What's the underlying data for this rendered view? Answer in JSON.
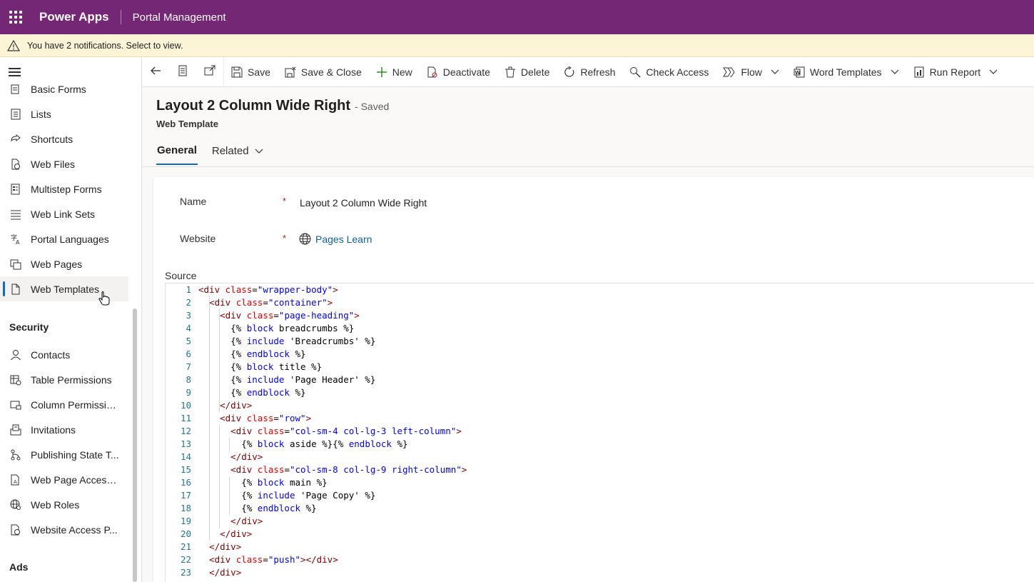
{
  "topbar": {
    "app_name": "Power Apps",
    "app_sub": "Portal Management"
  },
  "notification": {
    "text": "You have 2 notifications. Select to view."
  },
  "sidebar": {
    "items": [
      {
        "label": "Basic Forms",
        "icon": "form-icon"
      },
      {
        "label": "Lists",
        "icon": "list-icon"
      },
      {
        "label": "Shortcuts",
        "icon": "shortcut-icon"
      },
      {
        "label": "Web Files",
        "icon": "web-file-icon"
      },
      {
        "label": "Multistep Forms",
        "icon": "multistep-icon"
      },
      {
        "label": "Web Link Sets",
        "icon": "link-sets-icon"
      },
      {
        "label": "Portal Languages",
        "icon": "language-icon"
      },
      {
        "label": "Web Pages",
        "icon": "web-pages-icon"
      },
      {
        "label": "Web Templates",
        "icon": "template-icon",
        "active": true
      }
    ],
    "security_header": "Security",
    "security_items": [
      {
        "label": "Contacts",
        "icon": "person-icon"
      },
      {
        "label": "Table Permissions",
        "icon": "table-permission-icon"
      },
      {
        "label": "Column Permissio...",
        "icon": "column-permission-icon"
      },
      {
        "label": "Invitations",
        "icon": "invitation-icon"
      },
      {
        "label": "Publishing State T...",
        "icon": "publishing-icon"
      },
      {
        "label": "Web Page Access ...",
        "icon": "page-access-icon"
      },
      {
        "label": "Web Roles",
        "icon": "roles-icon"
      },
      {
        "label": "Website Access P...",
        "icon": "website-access-icon"
      }
    ],
    "ads_header": "Ads"
  },
  "commands": {
    "save": "Save",
    "save_close": "Save & Close",
    "new": "New",
    "deactivate": "Deactivate",
    "delete": "Delete",
    "refresh": "Refresh",
    "check_access": "Check Access",
    "flow": "Flow",
    "word_templates": "Word Templates",
    "run_report": "Run Report"
  },
  "header": {
    "title": "Layout 2 Column Wide Right",
    "saved": "- Saved",
    "entity": "Web Template",
    "tabs": [
      "General",
      "Related"
    ]
  },
  "form": {
    "name_label": "Name",
    "name_value": "Layout 2 Column Wide Right",
    "website_label": "Website",
    "website_value": "Pages Learn",
    "required_mark": "*",
    "source_label": "Source"
  },
  "editor": {
    "lines": [
      "<div class=\"wrapper-body\">",
      "  <div class=\"container\">",
      "    <div class=\"page-heading\">",
      "      {% block breadcrumbs %}",
      "      {% include 'Breadcrumbs' %}",
      "      {% endblock %}",
      "      {% block title %}",
      "      {% include 'Page Header' %}",
      "      {% endblock %}",
      "    </div>",
      "    <div class=\"row\">",
      "      <div class=\"col-sm-4 col-lg-3 left-column\">",
      "        {% block aside %}{% endblock %}",
      "      </div>",
      "      <div class=\"col-sm-8 col-lg-9 right-column\">",
      "        {% block main %}",
      "        {% include 'Page Copy' %}",
      "        {% endblock %}",
      "      </div>",
      "    </div>",
      "  </div>",
      "  <div class=\"push\"></div>",
      "  </div>"
    ]
  }
}
